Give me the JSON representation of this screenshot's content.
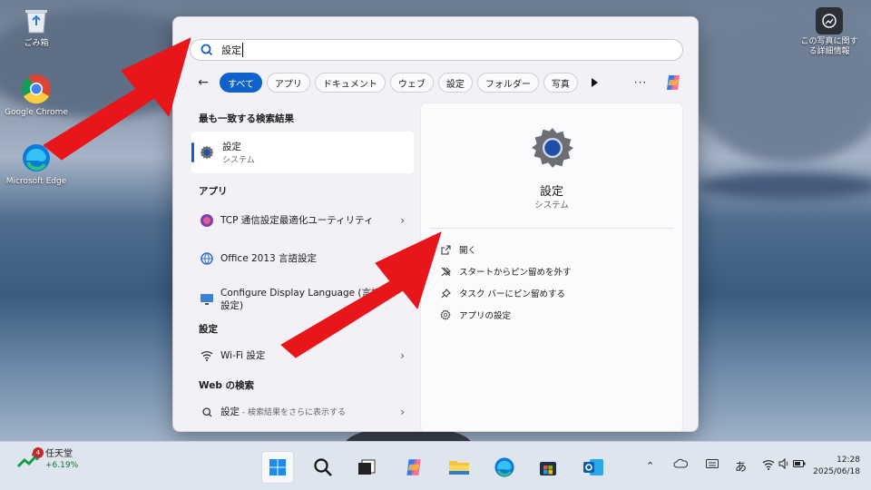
{
  "desktop": {
    "icons": [
      {
        "label": "ごみ箱",
        "icon": "recycle-bin-icon"
      },
      {
        "label": "Google Chrome",
        "icon": "chrome-icon"
      },
      {
        "label": "Microsoft Edge",
        "icon": "edge-icon"
      }
    ],
    "spotlight_label": "この写真に関する詳細情報"
  },
  "search": {
    "query": "設定",
    "filters": [
      "すべて",
      "アプリ",
      "ドキュメント",
      "ウェブ",
      "設定",
      "フォルダー",
      "写真"
    ],
    "active_filter": "すべて"
  },
  "results": {
    "best_match_title": "最も一致する検索結果",
    "best_match": {
      "name": "設定",
      "sub": "システム"
    },
    "apps_title": "アプリ",
    "apps": [
      {
        "name": "TCP 通信設定最適化ユーティリティ"
      },
      {
        "name": "Office 2013 言語設定"
      },
      {
        "name": "Configure Display Language (言語設定)"
      }
    ],
    "settings_title": "設定",
    "settings": [
      {
        "name": "Wi-Fi 設定"
      }
    ],
    "web_title": "Web の検索",
    "web": {
      "query": "設定",
      "hint": " - 検索結果をさらに表示する"
    }
  },
  "detail": {
    "title": "設定",
    "subtitle": "システム",
    "actions": [
      {
        "label": "開く",
        "icon": "open-external-icon"
      },
      {
        "label": "スタートからピン留めを外す",
        "icon": "unpin-icon"
      },
      {
        "label": "タスク バーにピン留めする",
        "icon": "pin-icon"
      },
      {
        "label": "アプリの設定",
        "icon": "gear-icon"
      }
    ]
  },
  "taskbar": {
    "stock": {
      "badge": "4",
      "name": "任天堂",
      "change": "+6.19%"
    },
    "ime": "あ",
    "time": "12:28",
    "date": "2025/06/18"
  },
  "colors": {
    "accent": "#0f62c9",
    "arrow": "#e8151b"
  }
}
